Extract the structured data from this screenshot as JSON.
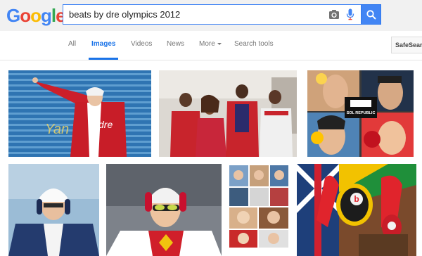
{
  "logo": {
    "letters": [
      {
        "char": "G",
        "color": "#4285f4"
      },
      {
        "char": "o",
        "color": "#ea4335"
      },
      {
        "char": "o",
        "color": "#fbbc05"
      },
      {
        "char": "g",
        "color": "#4285f4"
      },
      {
        "char": "l",
        "color": "#34a853"
      },
      {
        "char": "e",
        "color": "#ea4335"
      }
    ]
  },
  "search": {
    "query": "beats by dre olympics 2012"
  },
  "nav": {
    "tabs": [
      {
        "label": "All",
        "active": false
      },
      {
        "label": "Images",
        "active": true
      },
      {
        "label": "Videos",
        "active": false
      },
      {
        "label": "News",
        "active": false
      },
      {
        "label": "More",
        "active": false,
        "dropdown": true
      },
      {
        "label": "Search tools",
        "active": false
      }
    ],
    "safesearch_label": "SafeSearch"
  },
  "results": {
    "row1": [
      {
        "caption": "Yan"
      },
      {
        "caption": ""
      },
      {
        "caption": "SOL REPUBLIC"
      }
    ],
    "row2": [
      {
        "caption": ""
      },
      {
        "caption": ""
      },
      {
        "caption": ""
      },
      {
        "caption": "b"
      }
    ]
  },
  "colors": {
    "accent": "#4285f4",
    "active_tab": "#1a73e8",
    "header_bg": "#f1f1f1"
  }
}
